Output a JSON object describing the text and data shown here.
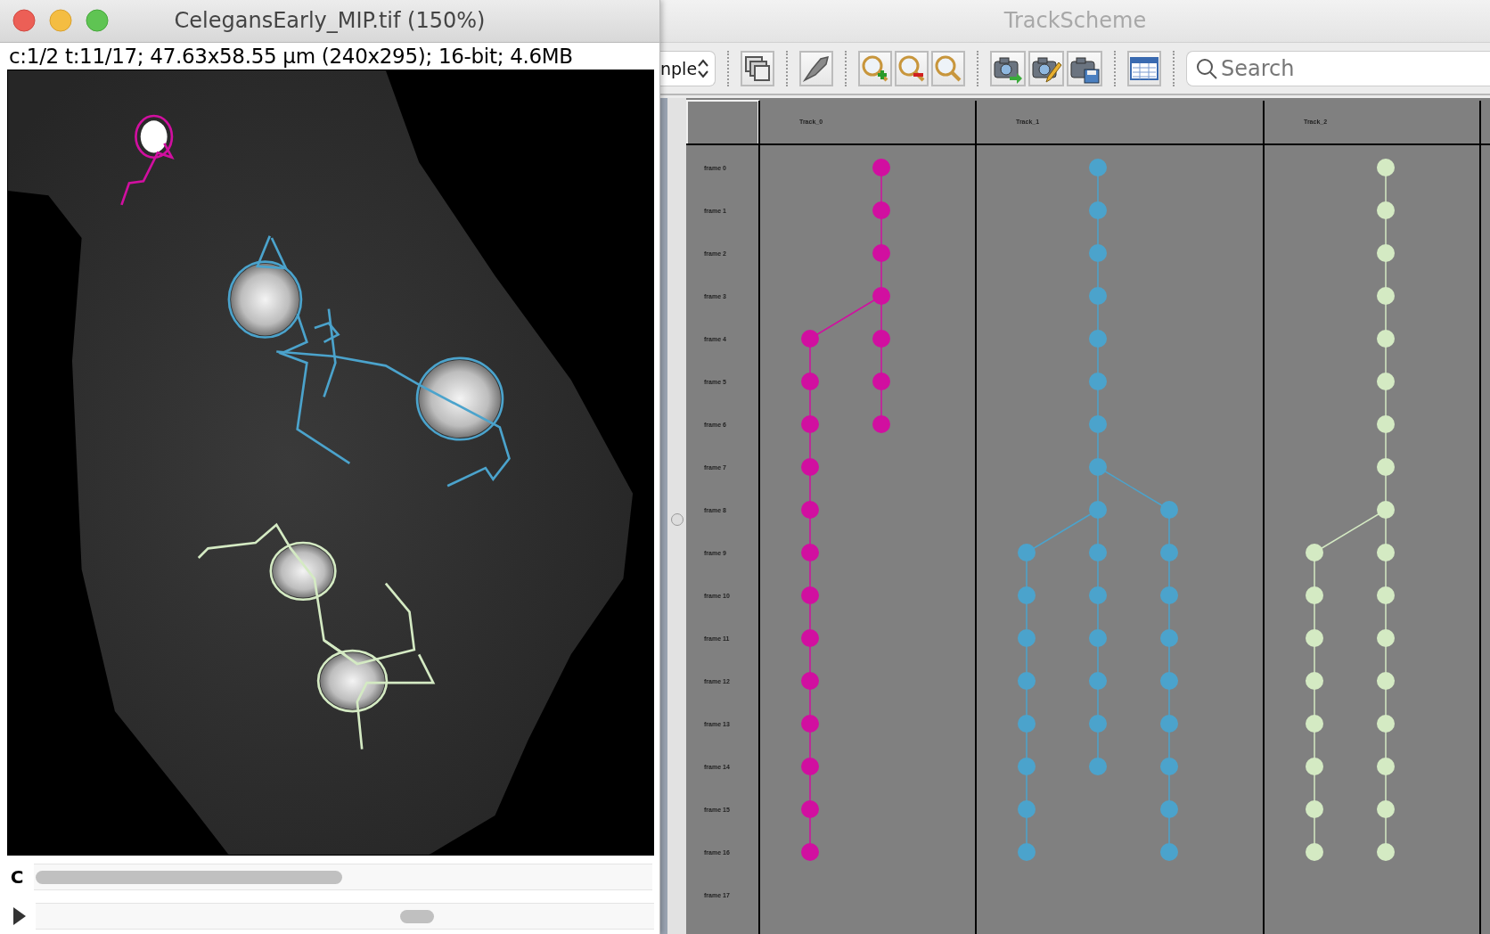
{
  "image_window": {
    "title": "CelegansEarly_MIP.tif (150%)",
    "info": "c:1/2 t:11/17; 47.63x58.55 µm (240x295); 16-bit; 4.6MB",
    "channel_label": "C"
  },
  "trackscheme": {
    "title": "TrackScheme",
    "layout_dropdown": "nple",
    "search": {
      "placeholder": "Search"
    },
    "frames": [
      "frame 0",
      "frame 1",
      "frame 2",
      "frame 3",
      "frame 4",
      "frame 5",
      "frame 6",
      "frame 7",
      "frame 8",
      "frame 9",
      "frame 10",
      "frame 11",
      "frame 12",
      "frame 13",
      "frame 14",
      "frame 15",
      "frame 16",
      "frame 17"
    ],
    "tracks": [
      {
        "name": "Track_0",
        "color": "#d10fa0",
        "root": {
          "children": [
            {
              "children": [
                {
                  "children": [
                    {
                      "children": [
                        {
                          "kind": "branch",
                          "children": [
                            {
                              "children": [
                                {
                                  "children": [
                                    {
                                      "children": [
                                        {
                                          "children": [
                                            {
                                              "children": [
                                                {
                                                  "children": [
                                                    {
                                                      "children": [
                                                        {
                                                          "children": [
                                                            {
                                                              "children": [
                                                                {
                                                                  "children": [
                                                                    {
                                                                      "children": [
                                                                        {
                                                                          "kind": "end"
                                                                        }
                                                                      ]
                                                                    }
                                                                  ]
                                                                }
                                                              ]
                                                            }
                                                          ]
                                                        }
                                                      ]
                                                    }
                                                  ]
                                                }
                                              ]
                                            }
                                          ]
                                        }
                                      ]
                                    }
                                  ]
                                }
                              ]
                            }
                          ]
                        },
                        {
                          "kind": "continue",
                          "children": [
                            {
                              "children": [
                                {
                                  "kind": "end"
                                }
                              ]
                            }
                          ]
                        }
                      ]
                    }
                  ]
                }
              ]
            }
          ]
        }
      },
      {
        "name": "Track_1",
        "color": "#4ba3cc",
        "root": {
          "children": [
            {
              "children": [
                {
                  "children": [
                    {
                      "children": [
                        {
                          "children": [
                            {
                              "children": [
                                {
                                  "children": [
                                    {
                                      "children": [
                                        {
                                          "kind": "continue",
                                          "children": [
                                            {
                                              "kind": "branch",
                                              "children": [
                                                {
                                                  "children": [
                                                    {
                                                      "children": [
                                                        {
                                                          "children": [
                                                            {
                                                              "children": [
                                                                {
                                                                  "children": [
                                                                    {
                                                                      "children": [
                                                                        {
                                                                          "kind": "end"
                                                                        }
                                                                      ]
                                                                    }
                                                                  ]
                                                                }
                                                              ]
                                                            }
                                                          ]
                                                        }
                                                      ]
                                                    }
                                                  ]
                                                }
                                              ]
                                            },
                                            {
                                              "kind": "continue",
                                              "children": [
                                                {
                                                  "children": [
                                                    {
                                                      "children": [
                                                        {
                                                          "children": [
                                                            {
                                                              "children": [
                                                                {
                                                                  "kind": "end"
                                                                }
                                                              ]
                                                            }
                                                          ]
                                                        }
                                                      ]
                                                    }
                                                  ]
                                                }
                                              ]
                                            }
                                          ]
                                        },
                                        {
                                          "kind": "branch",
                                          "children": [
                                            {
                                              "children": [
                                                {
                                                  "children": [
                                                    {
                                                      "children": [
                                                        {
                                                          "children": [
                                                            {
                                                              "children": [
                                                                {
                                                                  "children": [
                                                                    {
                                                                      "children": [
                                                                        {
                                                                          "kind": "end"
                                                                        }
                                                                      ]
                                                                    }
                                                                  ]
                                                                }
                                                              ]
                                                            }
                                                          ]
                                                        }
                                                      ]
                                                    }
                                                  ]
                                                }
                                              ]
                                            }
                                          ]
                                        }
                                      ]
                                    }
                                  ]
                                }
                              ]
                            }
                          ]
                        }
                      ]
                    }
                  ]
                }
              ]
            }
          ]
        }
      },
      {
        "name": "Track_2",
        "color": "#d4eac3",
        "root": {
          "children": [
            {
              "children": [
                {
                  "children": [
                    {
                      "children": [
                        {
                          "children": [
                            {
                              "children": [
                                {
                                  "children": [
                                    {
                                      "children": [
                                        {
                                          "children": [
                                            {
                                              "kind": "branch",
                                              "children": [
                                                {
                                                  "children": [
                                                    {
                                                      "children": [
                                                        {
                                                          "children": [
                                                            {
                                                              "children": [
                                                                {
                                                                  "children": [
                                                                    {
                                                                      "children": [
                                                                        {
                                                                          "kind": "end"
                                                                        }
                                                                      ]
                                                                    }
                                                                  ]
                                                                }
                                                              ]
                                                            }
                                                          ]
                                                        }
                                                      ]
                                                    }
                                                  ]
                                                }
                                              ]
                                            },
                                            {
                                              "kind": "continue",
                                              "children": [
                                                {
                                                  "children": [
                                                    {
                                                      "children": [
                                                        {
                                                          "children": [
                                                            {
                                                              "children": [
                                                                {
                                                                  "children": [
                                                                    {
                                                                      "children": [
                                                                        {
                                                                          "kind": "end"
                                                                        }
                                                                      ]
                                                                    }
                                                                  ]
                                                                }
                                                              ]
                                                            }
                                                          ]
                                                        }
                                                      ]
                                                    }
                                                  ]
                                                }
                                              ]
                                            }
                                          ]
                                        }
                                      ]
                                    }
                                  ]
                                }
                              ]
                            }
                          ]
                        }
                      ]
                    }
                  ]
                }
              ]
            }
          ]
        }
      }
    ]
  }
}
